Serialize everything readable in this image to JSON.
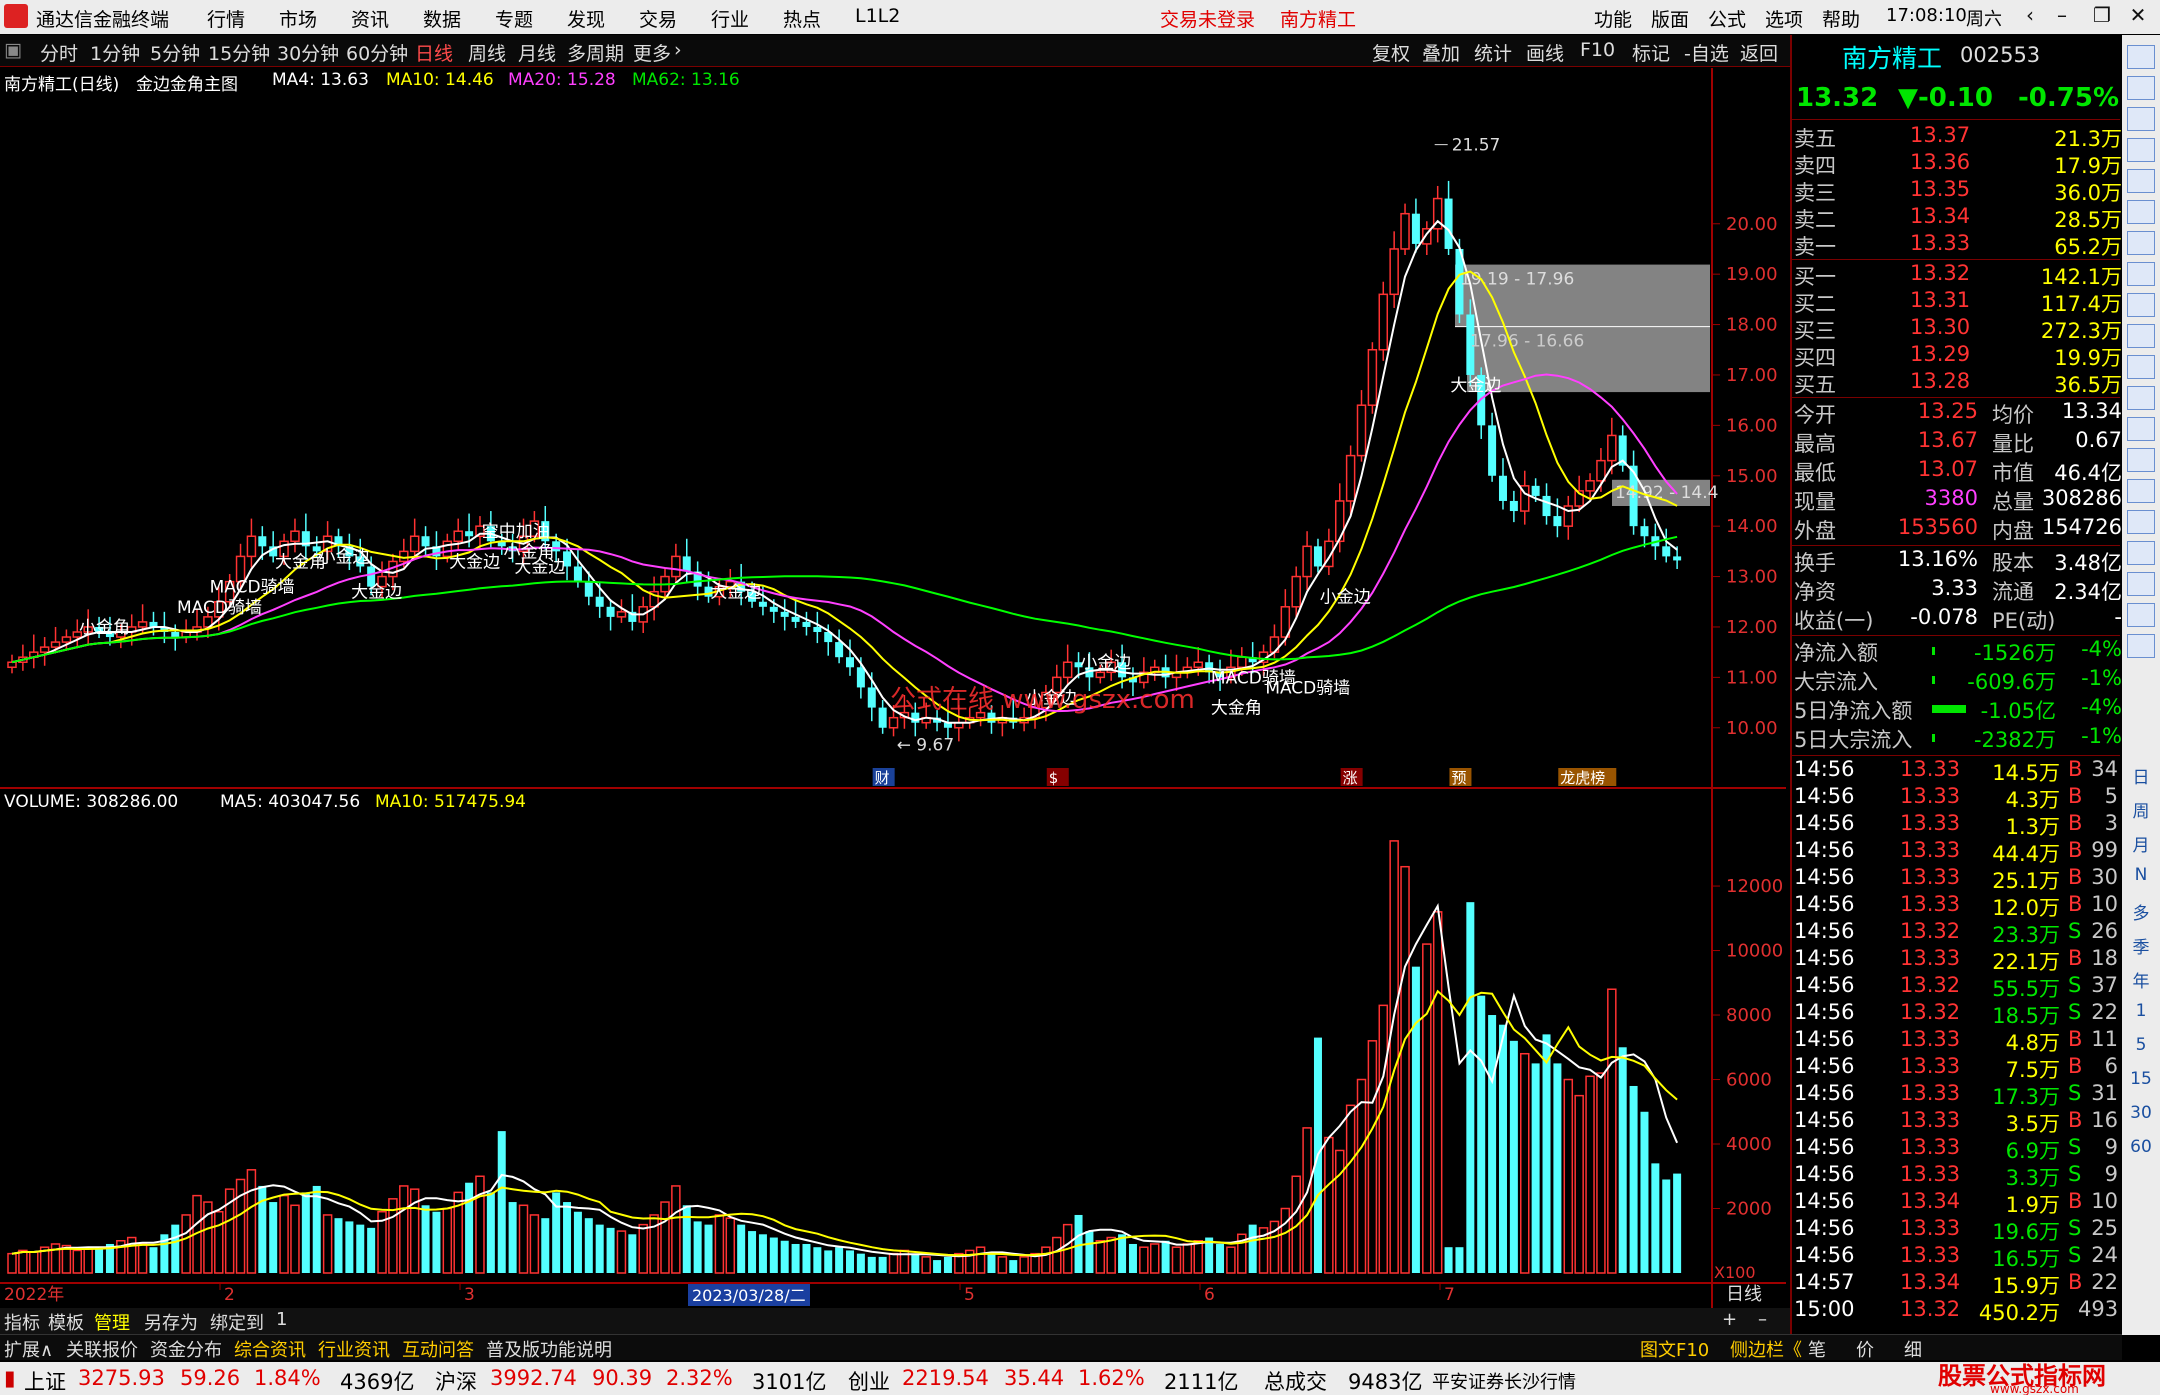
{
  "menu": {
    "app": "通达信金融终端",
    "items": [
      "行情",
      "市场",
      "资讯",
      "数据",
      "专题",
      "发现",
      "交易",
      "行业",
      "热点",
      "L1L2"
    ],
    "trade_status": "交易未登录",
    "stock": "南方精工",
    "right_items": [
      "功能",
      "版面",
      "公式",
      "选项",
      "帮助"
    ],
    "time": "17:08:10",
    "weekday": "周六"
  },
  "toolbar": {
    "periods": [
      "分时",
      "1分钟",
      "5分钟",
      "15分钟",
      "30分钟",
      "60分钟",
      "日线",
      "周线",
      "月线",
      "多周期",
      "更多"
    ],
    "active": "日线",
    "right": [
      "复权",
      "叠加",
      "统计",
      "画线",
      "F10",
      "标记",
      "-自选",
      "返回"
    ]
  },
  "main_legend": {
    "title": "南方精工(日线)",
    "formula": "金边金角主图",
    "ma4": "MA4: 13.63",
    "ma10": "MA10: 14.46",
    "ma20": "MA20: 15.28",
    "ma62": "MA62: 13.16"
  },
  "vol_legend": {
    "volume": "VOLUME: 308286.00",
    "ma5": "MA5: 403047.56",
    "ma10": "MA10: 517475.94"
  },
  "price_axis": [
    "20.00",
    "19.00",
    "18.00",
    "17.00",
    "16.00",
    "15.00",
    "14.00",
    "13.00",
    "12.00",
    "11.00",
    "10.00"
  ],
  "vol_axis": [
    "12000",
    "10000",
    "8000",
    "6000",
    "4000",
    "2000"
  ],
  "vol_unit": "X100",
  "date_axis": {
    "start": "2022年",
    "months": [
      "2",
      "3",
      "5",
      "6",
      "7"
    ],
    "cursor": "2023/03/28/二",
    "right": "日线"
  },
  "annotations": {
    "high": "21.57",
    "low": "9.67",
    "zone1": "19.19 - 17.96",
    "zone2": "17.96 - 16.66",
    "zone3": "14.92 - 14.4",
    "labels": [
      "小金角",
      "MACD骑墙",
      "MACD骑墙",
      "大金角",
      "小金边",
      "大金边",
      "大金边",
      "空中加油",
      "小金角",
      "大金边",
      "大金边",
      "小金边",
      "小金边",
      "MACD骑墙",
      "MACD骑墙",
      "大金角",
      "小金边",
      "大金边"
    ],
    "events": [
      "财",
      "$",
      "涨",
      "预",
      "龙虎榜"
    ],
    "watermark": "公式在线 www.gszx.com"
  },
  "quote": {
    "name": "南方精工",
    "code": "002553",
    "price": "13.32",
    "change": "▼-0.10",
    "pct": "-0.75%",
    "asks": [
      {
        "l": "卖五",
        "p": "13.37",
        "v": "21.3万"
      },
      {
        "l": "卖四",
        "p": "13.36",
        "v": "17.9万"
      },
      {
        "l": "卖三",
        "p": "13.35",
        "v": "36.0万"
      },
      {
        "l": "卖二",
        "p": "13.34",
        "v": "28.5万"
      },
      {
        "l": "卖一",
        "p": "13.33",
        "v": "65.2万"
      }
    ],
    "bids": [
      {
        "l": "买一",
        "p": "13.32",
        "v": "142.1万"
      },
      {
        "l": "买二",
        "p": "13.31",
        "v": "117.4万"
      },
      {
        "l": "买三",
        "p": "13.30",
        "v": "272.3万"
      },
      {
        "l": "买四",
        "p": "13.29",
        "v": "19.9万"
      },
      {
        "l": "买五",
        "p": "13.28",
        "v": "36.5万"
      }
    ],
    "stats": [
      {
        "a": "今开",
        "av": "13.25",
        "b": "均价",
        "bv": "13.34"
      },
      {
        "a": "最高",
        "av": "13.67",
        "b": "量比",
        "bv": "0.67"
      },
      {
        "a": "最低",
        "av": "13.07",
        "b": "市值",
        "bv": "46.4亿"
      },
      {
        "a": "现量",
        "av": "3380",
        "b": "总量",
        "bv": "308286"
      },
      {
        "a": "外盘",
        "av": "153560",
        "b": "内盘",
        "bv": "154726"
      }
    ],
    "stats2": [
      {
        "a": "换手",
        "av": "13.16%",
        "b": "股本",
        "bv": "3.48亿"
      },
      {
        "a": "净资",
        "av": "3.33",
        "b": "流通",
        "bv": "2.34亿"
      },
      {
        "a": "收益(一)",
        "av": "-0.078",
        "b": "PE(动)",
        "bv": "-"
      }
    ],
    "flows": [
      {
        "l": "净流入额",
        "v": "-1526万",
        "p": "-4%"
      },
      {
        "l": "大宗流入",
        "v": "-609.6万",
        "p": "-1%"
      },
      {
        "l": "5日净流入额",
        "v": "-1.05亿",
        "p": "-4%"
      },
      {
        "l": "5日大宗流入",
        "v": "-2382万",
        "p": "-1%"
      }
    ],
    "ticks": [
      [
        "14:56",
        "13.33",
        "14.5万",
        "B",
        "34"
      ],
      [
        "14:56",
        "13.33",
        "4.3万",
        "B",
        "5"
      ],
      [
        "14:56",
        "13.33",
        "1.3万",
        "B",
        "3"
      ],
      [
        "14:56",
        "13.33",
        "44.4万",
        "B",
        "99"
      ],
      [
        "14:56",
        "13.33",
        "25.1万",
        "B",
        "30"
      ],
      [
        "14:56",
        "13.33",
        "12.0万",
        "B",
        "10"
      ],
      [
        "14:56",
        "13.32",
        "23.3万",
        "S",
        "26"
      ],
      [
        "14:56",
        "13.33",
        "22.1万",
        "B",
        "18"
      ],
      [
        "14:56",
        "13.32",
        "55.5万",
        "S",
        "37"
      ],
      [
        "14:56",
        "13.32",
        "18.5万",
        "S",
        "22"
      ],
      [
        "14:56",
        "13.33",
        "4.8万",
        "B",
        "11"
      ],
      [
        "14:56",
        "13.33",
        "7.5万",
        "B",
        "6"
      ],
      [
        "14:56",
        "13.33",
        "17.3万",
        "S",
        "31"
      ],
      [
        "14:56",
        "13.33",
        "3.5万",
        "B",
        "16"
      ],
      [
        "14:56",
        "13.33",
        "6.9万",
        "S",
        "9"
      ],
      [
        "14:56",
        "13.33",
        "3.3万",
        "S",
        "9"
      ],
      [
        "14:56",
        "13.34",
        "1.9万",
        "B",
        "10"
      ],
      [
        "14:56",
        "13.33",
        "19.6万",
        "S",
        "25"
      ],
      [
        "14:56",
        "13.33",
        "16.5万",
        "S",
        "24"
      ],
      [
        "14:57",
        "13.34",
        "15.9万",
        "B",
        "22"
      ],
      [
        "15:00",
        "13.32",
        "450.2万",
        "",
        "493"
      ]
    ]
  },
  "bottom": {
    "tabs": [
      "指标",
      "模板",
      "管理",
      "另存为",
      "绑定到",
      "1"
    ],
    "tabs2": [
      "扩展∧",
      "关联报价",
      "资金分布",
      "综合资讯",
      "行业资讯",
      "互动问答",
      "普及版功能说明"
    ],
    "right": [
      "图文F10",
      "侧边栏《",
      "笔",
      "价",
      "细"
    ]
  },
  "status": {
    "sh_label": "上证",
    "sh": "3275.93",
    "sh_chg": "59.26",
    "sh_pct": "1.84%",
    "sh_amt": "4369亿",
    "hs_label": "沪深",
    "hs": "3992.74",
    "hs_chg": "90.39",
    "hs_pct": "2.32%",
    "hs_amt": "3101亿",
    "cy_label": "创业",
    "cy": "2219.54",
    "cy_chg": "35.44",
    "cy_pct": "1.62%",
    "cy_amt": "2111亿",
    "total_label": "总成交",
    "total": "9483亿",
    "broker": "平安证券长沙行情",
    "brand": "股票公式指标网",
    "brand_url": "www.gszx.com"
  },
  "sidebar": [
    "日",
    "周",
    "月",
    "N",
    "多",
    "季",
    "年",
    "1",
    "5",
    "15",
    "30",
    "60"
  ],
  "chart_data": {
    "type": "candlestick",
    "ylim": [
      9.67,
      21.57
    ],
    "vol_ylim": [
      0,
      13000
    ],
    "closes": [
      11.3,
      11.4,
      11.5,
      11.6,
      11.7,
      11.8,
      11.9,
      12.0,
      11.9,
      11.8,
      11.9,
      12.0,
      12.1,
      12.0,
      11.9,
      11.8,
      11.9,
      12.0,
      12.2,
      12.5,
      12.9,
      13.4,
      13.8,
      13.6,
      13.4,
      13.7,
      13.9,
      13.6,
      13.5,
      13.8,
      13.6,
      13.4,
      13.2,
      12.8,
      13.0,
      13.3,
      13.5,
      13.8,
      13.6,
      13.4,
      13.7,
      13.9,
      13.8,
      14.0,
      13.7,
      13.6,
      13.5,
      13.8,
      14.1,
      13.7,
      13.5,
      13.2,
      12.9,
      12.6,
      12.4,
      12.2,
      12.3,
      12.1,
      12.4,
      12.7,
      13.0,
      13.4,
      13.1,
      12.8,
      12.6,
      12.8,
      12.9,
      12.7,
      12.5,
      12.4,
      12.3,
      12.2,
      12.1,
      12.0,
      11.9,
      11.7,
      11.4,
      11.2,
      10.8,
      10.4,
      10.0,
      10.2,
      10.3,
      10.1,
      10.2,
      10.1,
      10.0,
      10.1,
      10.2,
      10.3,
      10.1,
      10.2,
      10.1,
      10.2,
      10.4,
      10.7,
      11.0,
      11.3,
      11.2,
      11.0,
      11.1,
      11.3,
      11.0,
      10.9,
      11.1,
      11.2,
      11.0,
      11.1,
      11.2,
      11.3,
      11.1,
      11.0,
      11.2,
      11.4,
      11.3,
      11.5,
      11.8,
      12.4,
      13.0,
      13.6,
      13.2,
      13.7,
      14.5,
      15.4,
      16.4,
      17.5,
      18.6,
      19.5,
      20.2,
      19.6,
      19.9,
      20.5,
      19.5,
      18.2,
      17.0,
      16.0,
      15.0,
      14.5,
      14.3,
      14.8,
      14.6,
      14.2,
      14.0,
      14.4,
      14.7,
      14.9,
      15.3,
      15.8,
      15.2,
      14.0,
      13.8,
      13.6,
      13.4,
      13.32
    ],
    "volumes": [
      600,
      700,
      650,
      800,
      900,
      850,
      700,
      750,
      800,
      900,
      1000,
      1100,
      900,
      800,
      1200,
      1500,
      1800,
      2400,
      2200,
      1900,
      2600,
      2900,
      3200,
      2700,
      2200,
      2400,
      2100,
      2500,
      2700,
      1800,
      1700,
      1600,
      1500,
      1400,
      1900,
      2300,
      2700,
      2600,
      2100,
      1900,
      2000,
      2500,
      2800,
      3000,
      2500,
      4400,
      2200,
      2100,
      1800,
      1700,
      2500,
      2200,
      1900,
      1700,
      1500,
      1400,
      1300,
      1200,
      1500,
      1800,
      2200,
      2700,
      2100,
      1600,
      1500,
      1800,
      1700,
      1500,
      1300,
      1200,
      1100,
      1000,
      900,
      900,
      800,
      700,
      800,
      700,
      600,
      500,
      500,
      600,
      700,
      600,
      500,
      400,
      500,
      600,
      700,
      800,
      600,
      500,
      400,
      500,
      600,
      800,
      1100,
      1500,
      1800,
      1300,
      1000,
      1100,
      1200,
      900,
      800,
      900,
      1000,
      800,
      900,
      1000,
      1100,
      900,
      800,
      1200,
      1500,
      1400,
      1600,
      2000,
      3000,
      4500,
      7300,
      4200,
      3800,
      5200,
      6000,
      7200,
      8300,
      13400,
      12600,
      9500,
      10200,
      11200,
      800,
      800,
      11500,
      8600,
      8000,
      7700,
      7200,
      6800,
      6500,
      7400,
      6500,
      6000,
      5500,
      6100,
      6200,
      8800,
      7000,
      5800,
      5000,
      3400,
      2900,
      3083
    ]
  }
}
